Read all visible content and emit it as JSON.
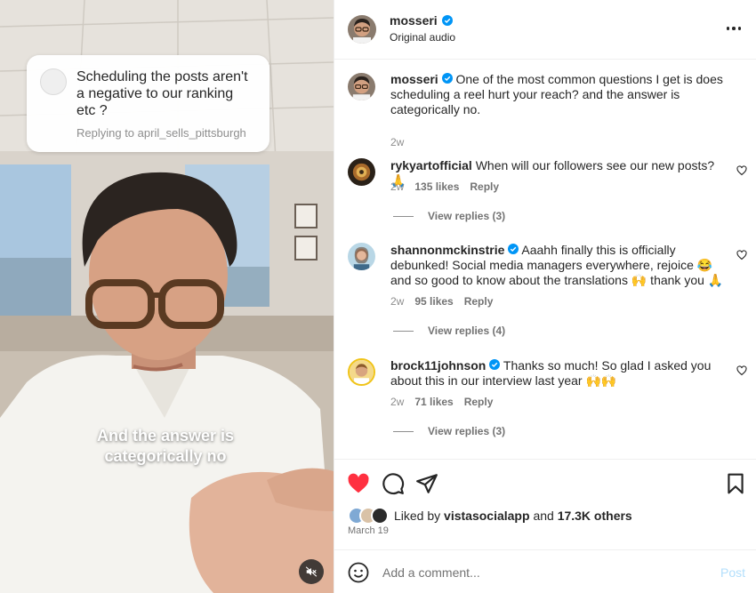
{
  "video": {
    "reply_bubble": {
      "text": "Scheduling the posts aren't a negative to our ranking etc ?",
      "subtext": "Replying to april_sells_pittsburgh"
    },
    "caption": "And the answer is categorically no",
    "mute_icon": "muted-speaker-icon"
  },
  "header": {
    "username": "mosseri",
    "verified": true,
    "audio": "Original audio",
    "more_icon": "more-options-icon"
  },
  "comments": [
    {
      "username": "mosseri",
      "verified": true,
      "text": "One of the most common questions I get is does scheduling a reel hurt your reach? and the answer is categorically no.",
      "time": "2w",
      "likes": "",
      "reply_label": "",
      "view_replies": ""
    },
    {
      "username": "rykyartofficial",
      "verified": false,
      "text": "When will our followers see our new posts? 🙏",
      "time": "2w",
      "likes": "135 likes",
      "reply_label": "Reply",
      "view_replies": "View replies (3)"
    },
    {
      "username": "shannonmckinstrie",
      "verified": true,
      "text": "Aaahh finally this is officially debunked! Social media managers everywhere, rejoice 😂 and so good to know about the translations 🙌 thank you 🙏",
      "time": "2w",
      "likes": "95 likes",
      "reply_label": "Reply",
      "view_replies": "View replies (4)"
    },
    {
      "username": "brock11johnson",
      "verified": true,
      "text": "Thanks so much! So glad I asked you about this in our interview last year 🙌🙌",
      "time": "2w",
      "likes": "71 likes",
      "reply_label": "Reply",
      "view_replies": "View replies (3)"
    }
  ],
  "actions": {
    "liked_prefix": "Liked by",
    "liked_user": "vistasocialapp",
    "liked_and": "and",
    "liked_others": "17.3K others",
    "date": "March 19",
    "like_color": "#ff3040"
  },
  "comment_box": {
    "placeholder": "Add a comment...",
    "post_label": "Post"
  },
  "colors": {
    "verified": "#0095f6",
    "post_disabled": "#b2dffc",
    "secondary_text": "#737373"
  }
}
